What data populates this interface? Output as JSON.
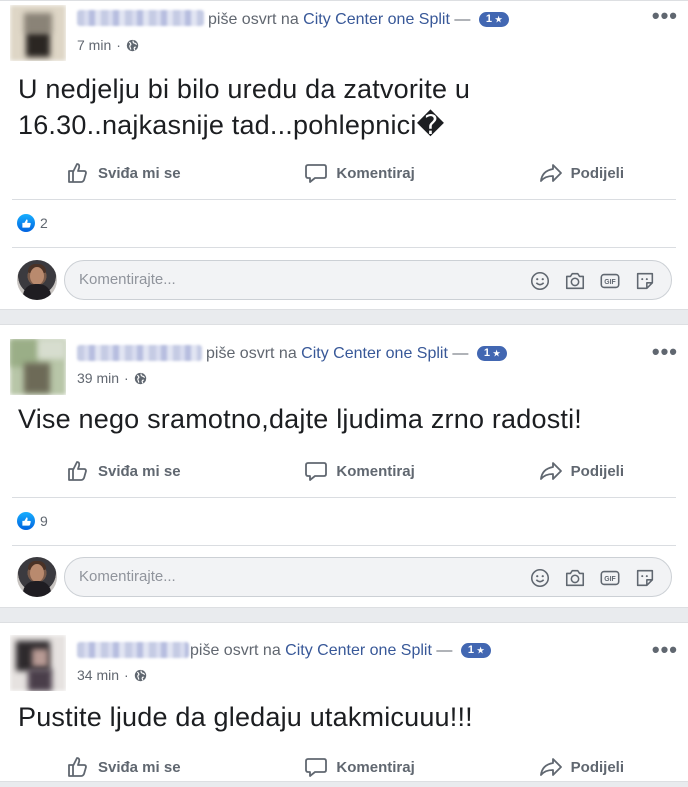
{
  "posts": [
    {
      "author_suffix": "piše osvrt na",
      "place": "City Center one Split",
      "dash": "—",
      "rating": "1",
      "rating_star": "★",
      "time": "7 min",
      "dot": "·",
      "text_line1": "U nedjelju bi bilo uredu da zatvorite u",
      "text_line2": "16.30..najkasnije tad...pohlepnici�",
      "like_label": "Sviđa mi se",
      "comment_label": "Komentiraj",
      "share_label": "Podijeli",
      "reaction_count": "2",
      "comment_placeholder": "Komentirajte..."
    },
    {
      "author_suffix": "piše osvrt na",
      "place": "City Center one Split",
      "dash": "—",
      "rating": "1",
      "rating_star": "★",
      "time": "39 min",
      "dot": "·",
      "text_line1": "Vise nego sramotno,dajte ljudima zrno radosti!",
      "like_label": "Sviđa mi se",
      "comment_label": "Komentiraj",
      "share_label": "Podijeli",
      "reaction_count": "9",
      "comment_placeholder": "Komentirajte..."
    },
    {
      "author_suffix": "piše osvrt na",
      "place": "City Center one Split",
      "dash": "—",
      "rating": "1",
      "rating_star": "★",
      "time": "34 min",
      "dot": "·",
      "text_line1": "Pustite ljude da gledaju utakmicuuu!!!",
      "like_label": "Sviđa mi se",
      "comment_label": "Komentiraj",
      "share_label": "Podijeli"
    }
  ],
  "icons": {
    "more": "more-options-icon",
    "globe": "globe-icon",
    "like": "thumbs-up-icon",
    "comment": "comment-bubble-icon",
    "share": "share-arrow-icon",
    "emoji": "emoji-icon",
    "camera": "camera-icon",
    "gif": "gif-icon",
    "sticker": "sticker-icon"
  },
  "colors": {
    "link": "#385898",
    "badge": "#4267b2",
    "text": "#1c1e21",
    "muted": "#606770"
  }
}
